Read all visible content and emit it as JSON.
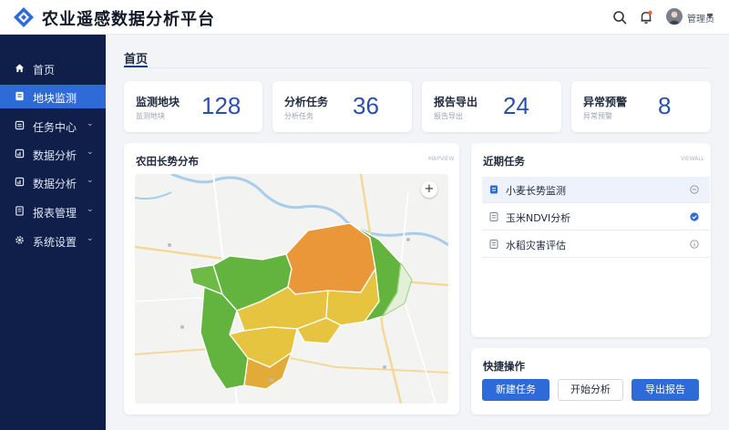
{
  "header": {
    "app_title": "农业遥感数据分析平台",
    "user_name": "管理员"
  },
  "sidebar": {
    "items": [
      {
        "label": "首页",
        "icon": "home-icon"
      },
      {
        "label": "地块监测",
        "icon": "monitor-icon",
        "active": true
      },
      {
        "label": "任务中心",
        "icon": "task-icon"
      },
      {
        "label": "数据分析",
        "icon": "data-icon"
      },
      {
        "label": "数据分析",
        "icon": "data-icon"
      },
      {
        "label": "报表管理",
        "icon": "report-icon"
      },
      {
        "label": "系统设置",
        "icon": "settings-icon"
      }
    ]
  },
  "page": {
    "title": "首页"
  },
  "stats": [
    {
      "label": "监测地块",
      "sub": "监测地块",
      "value": "128"
    },
    {
      "label": "分析任务",
      "sub": "分析任务",
      "value": "36"
    },
    {
      "label": "报告导出",
      "sub": "报告导出",
      "value": "24"
    },
    {
      "label": "异常预警",
      "sub": "异常预警",
      "value": "8"
    }
  ],
  "map_panel": {
    "title": "农田长势分布",
    "tag": "MAPVIEW"
  },
  "tasks_panel": {
    "title": "近期任务",
    "tag": "VIEWALL",
    "items": [
      {
        "label": "小麦长势监测",
        "status": "pending"
      },
      {
        "label": "玉米NDVI分析",
        "status": "done"
      },
      {
        "label": "水稻灾害评估",
        "status": "info"
      }
    ]
  },
  "quick_panel": {
    "title": "快捷操作",
    "buttons": [
      "新建任务",
      "开始分析",
      "导出报告"
    ]
  },
  "colors": {
    "sidebar_bg": "#0f1f4a",
    "accent": "#2f6bd8",
    "stat_value": "#2a4fb0",
    "field_green": "#63b33f",
    "field_yellow": "#e6c440",
    "field_orange": "#ea973a"
  }
}
